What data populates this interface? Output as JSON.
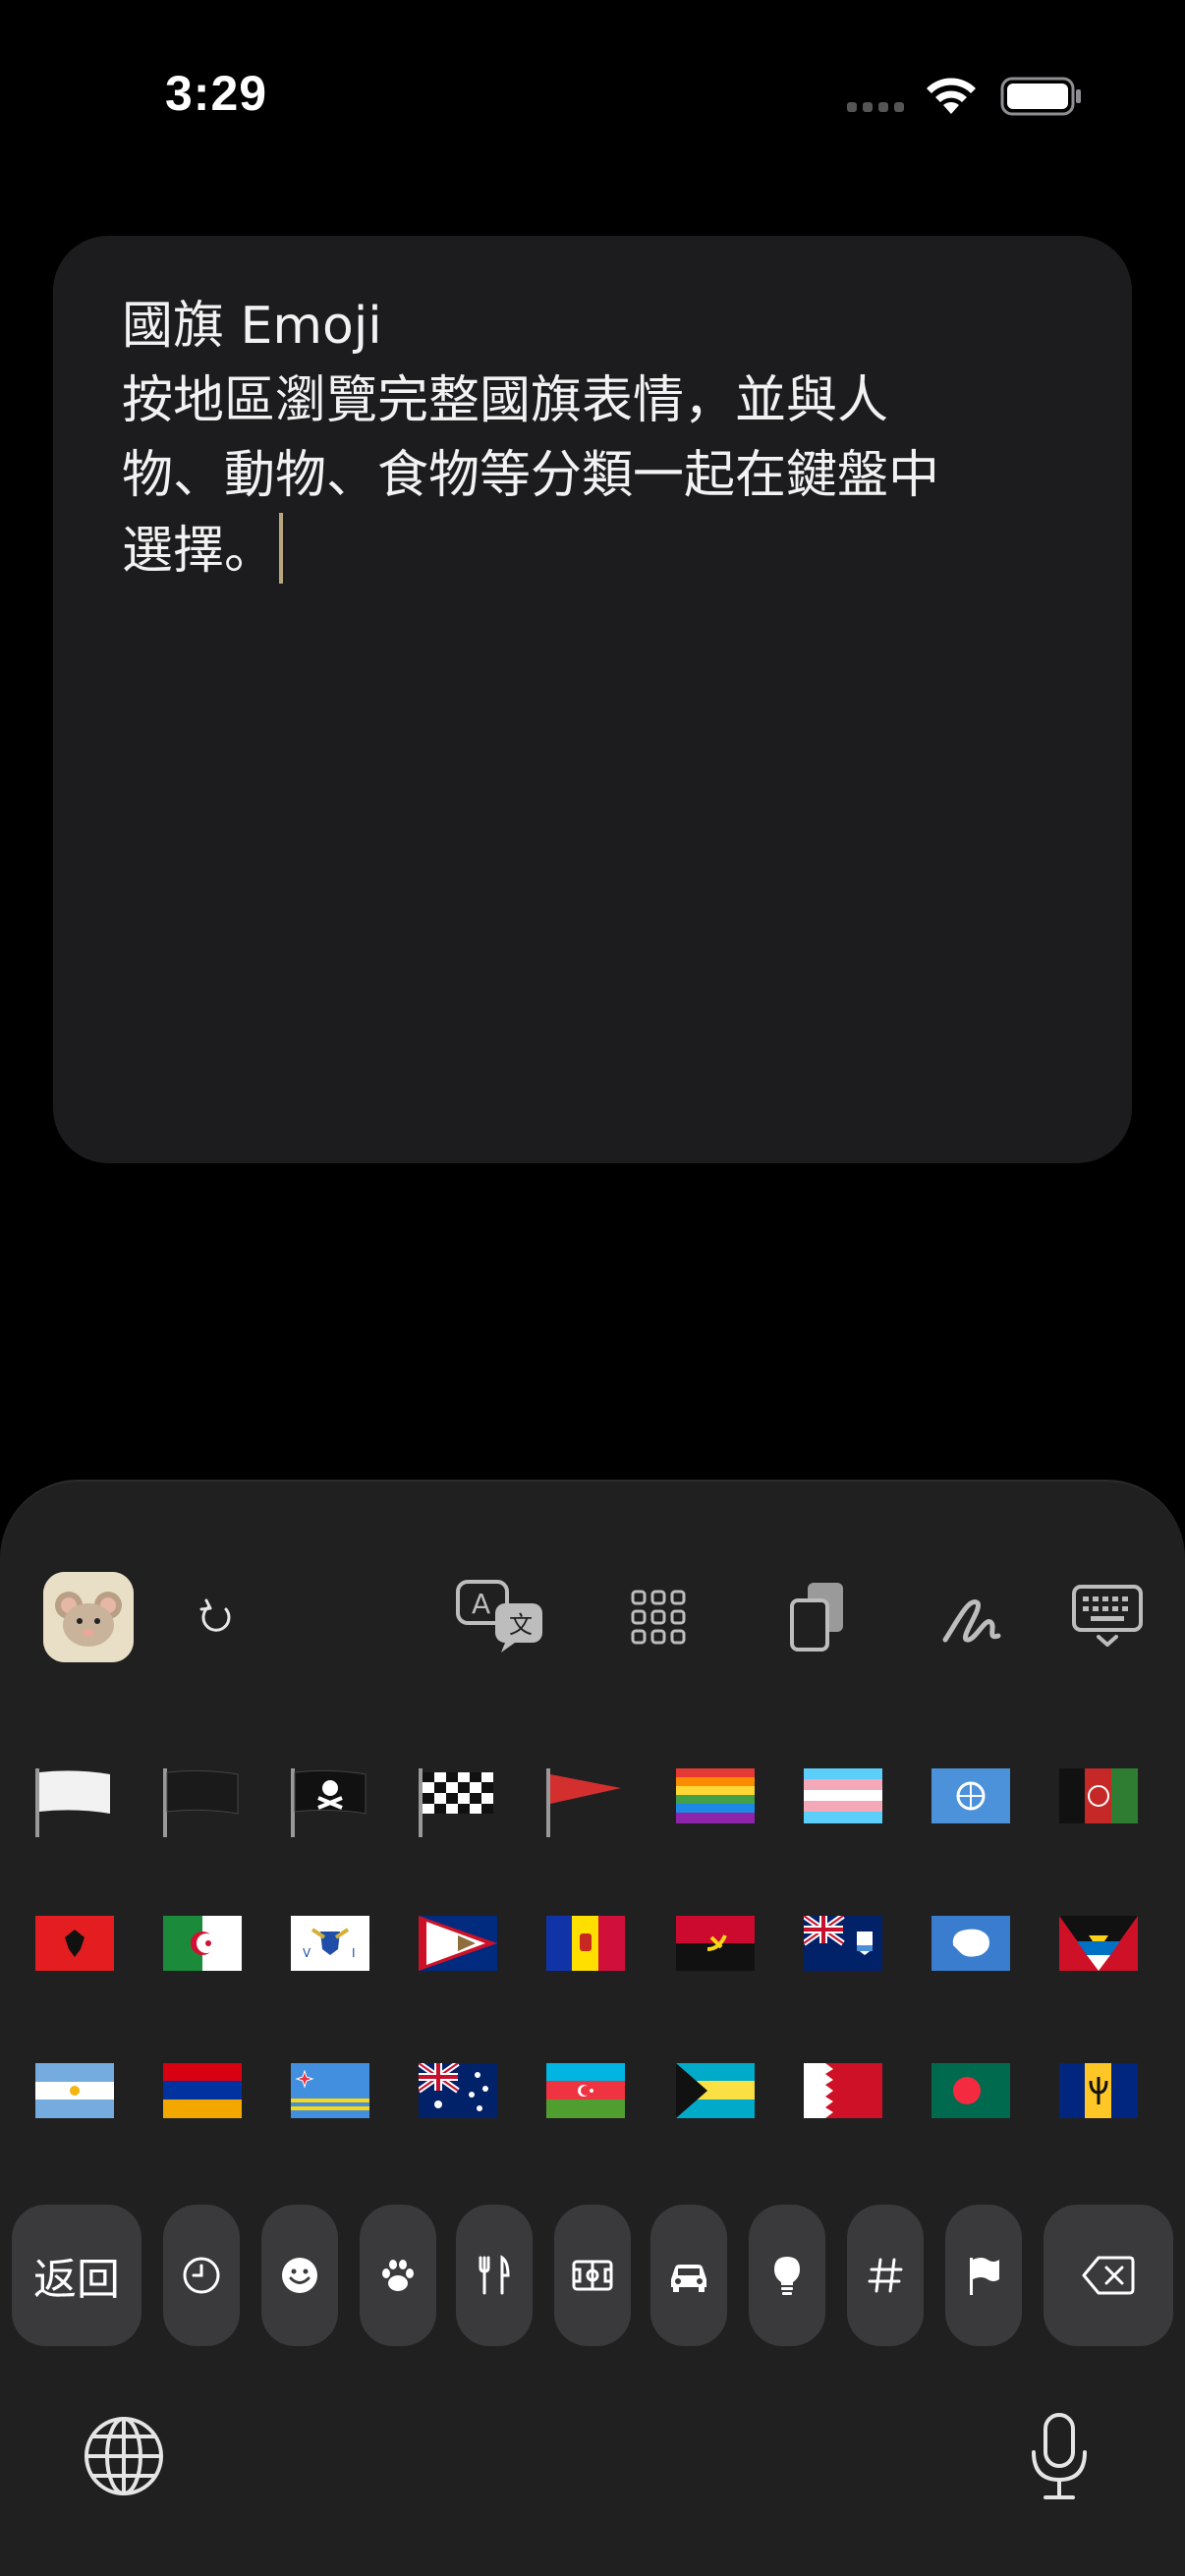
{
  "status_bar": {
    "time": "3:29"
  },
  "note": {
    "text": "國旗 Emoji\n按地區瀏覽完整國旗表情，並與人\n物、動物、食物等分類一起在鍵盤中\n選擇。"
  },
  "keyboard": {
    "toolbar": [
      "app-icon",
      "refresh-icon",
      "translate-icon",
      "grid-icon",
      "clipboard-icon",
      "scribble-icon",
      "keyboard-dismiss-icon"
    ],
    "flags_row1": [
      "white-flag",
      "black-flag",
      "pirate-flag",
      "checkered-flag",
      "triangular-flag",
      "rainbow-flag",
      "transgender-flag",
      "united-nations-flag",
      "afghanistan-flag"
    ],
    "flags_row2": [
      "albania-flag",
      "algeria-flag",
      "us-virgin-islands-flag",
      "american-samoa-flag",
      "andorra-flag",
      "angola-flag",
      "anguilla-flag",
      "antarctica-flag",
      "antigua-barbuda-flag"
    ],
    "flags_row3": [
      "argentina-flag",
      "armenia-flag",
      "aruba-flag",
      "australia-flag",
      "azerbaijan-flag",
      "bahamas-flag",
      "bahrain-flag",
      "bangladesh-flag",
      "barbados-flag"
    ],
    "categories": {
      "back_label": "返回",
      "items": [
        "clock-icon",
        "smiley-icon",
        "paw-icon",
        "fork-knife-icon",
        "soccer-field-icon",
        "car-icon",
        "lightbulb-icon",
        "hash-icon",
        "flag-icon"
      ]
    },
    "bottom": [
      "globe-icon",
      "microphone-icon"
    ]
  }
}
